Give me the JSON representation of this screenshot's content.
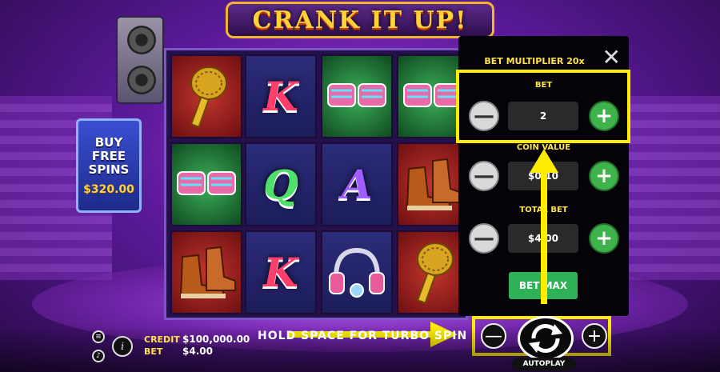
{
  "game": {
    "title": "CRANK IT UP!"
  },
  "buy_free_spins": {
    "label_line1": "BUY",
    "label_line2": "FREE",
    "label_line3": "SPINS",
    "price": "$320.00"
  },
  "reels": [
    [
      "microphone",
      "sunglasses",
      "sneakers"
    ],
    [
      "K",
      "Q",
      "K"
    ],
    [
      "sunglasses",
      "A",
      "headphones"
    ],
    [
      "sunglasses",
      "sneakers",
      "microphone"
    ]
  ],
  "bet_panel": {
    "title": "BET MULTIPLIER 20x",
    "close_icon": "close-icon",
    "bet_label": "BET",
    "bet_value": "2",
    "coin_value_label": "COIN VALUE",
    "coin_value": "$0.10",
    "total_bet_label": "TOTAL BET",
    "total_bet_value": "$4.00",
    "bet_max_label": "BET MAX",
    "minus_symbol": "—",
    "plus_symbol": "+"
  },
  "bottom_bar": {
    "credit_label": "CREDIT",
    "credit_value": "$100,000.00",
    "bet_label": "BET",
    "bet_value": "$4.00",
    "hold_text": "HOLD SPACE FOR TURBO SPIN",
    "autoplay_label": "AUTOPLAY",
    "menu_icon": "menu-icon",
    "info_icon": "info-icon",
    "sound_icon": "sound-icon"
  },
  "colors": {
    "highlight": "#ffec00",
    "panel_label": "#ffe24a",
    "plus_green": "#3fb24b",
    "bet_max_green": "#2fb257"
  }
}
